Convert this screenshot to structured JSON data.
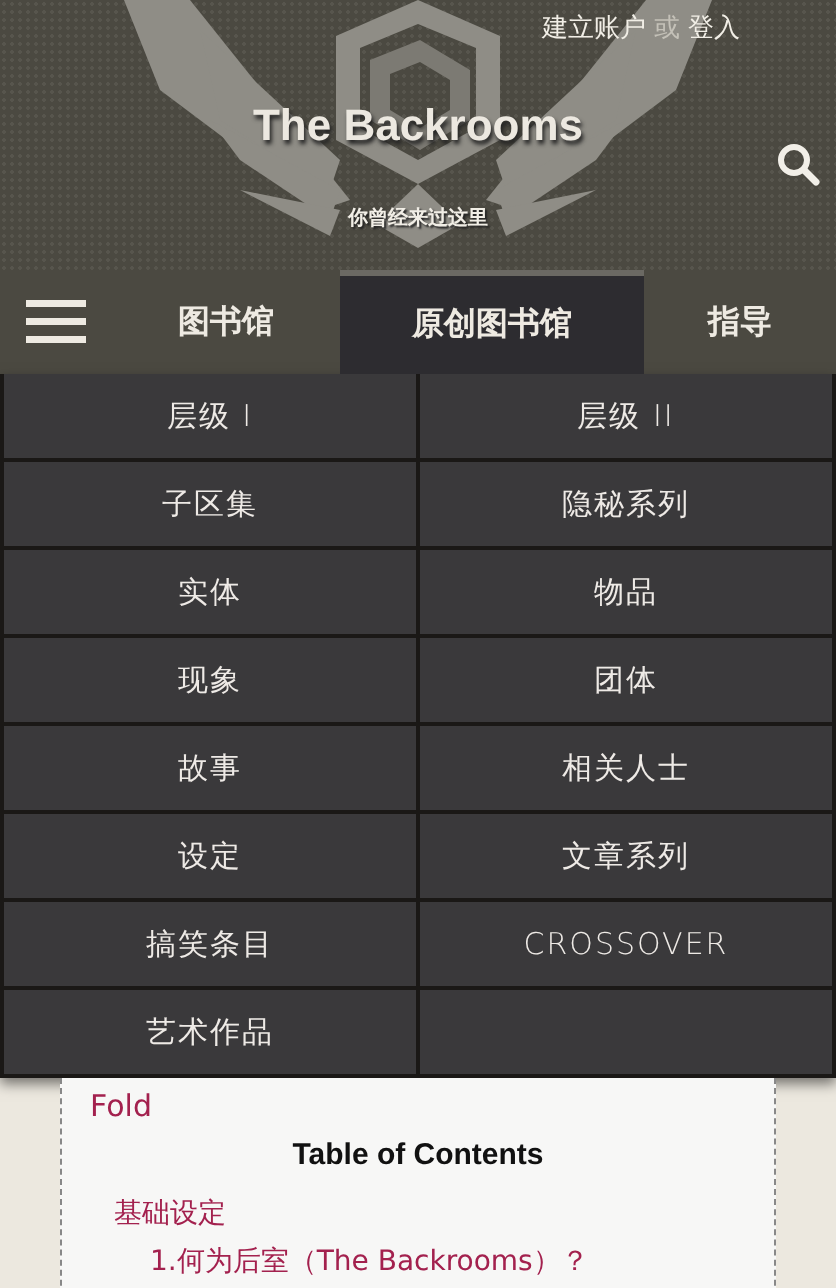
{
  "header": {
    "account_links": [
      {
        "label": "建立账户"
      },
      {
        "label": "或",
        "kind": "separator"
      },
      {
        "label": "登入"
      }
    ],
    "site_title": "The Backrooms",
    "tagline": "你曾经来过这里"
  },
  "nav": {
    "tabs": [
      {
        "label": "图书馆",
        "selected": false
      },
      {
        "label": "原创图书馆",
        "selected": true
      },
      {
        "label": "指导",
        "selected": false
      }
    ]
  },
  "dropdown": {
    "items": [
      {
        "label": "层级 I"
      },
      {
        "label": "层级 II"
      },
      {
        "label": "子区集"
      },
      {
        "label": "隐秘系列"
      },
      {
        "label": "实体"
      },
      {
        "label": "物品"
      },
      {
        "label": "现象"
      },
      {
        "label": "团体"
      },
      {
        "label": "故事"
      },
      {
        "label": "相关人士"
      },
      {
        "label": "设定"
      },
      {
        "label": "文章系列"
      },
      {
        "label": "搞笑条目"
      },
      {
        "label": "CROSSOVER"
      },
      {
        "label": "艺术作品"
      }
    ]
  },
  "toc": {
    "fold_link": "Fold",
    "title": "Table of Contents",
    "entries": [
      {
        "label": "基础设定",
        "children": [
          {
            "label": "1.何为后室（The Backrooms）？"
          }
        ]
      }
    ]
  }
}
